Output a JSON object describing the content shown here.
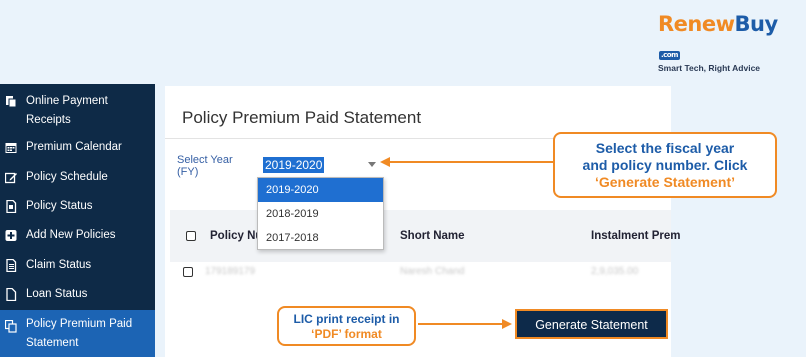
{
  "logo": {
    "renew": "Renew",
    "buy": "Buy",
    "com": ".com",
    "tagline": "Smart Tech, Right Advice"
  },
  "sidebar": {
    "items": [
      {
        "label": "Online Payment Receipts",
        "icon": "receipt-icon"
      },
      {
        "label": "Premium Calendar",
        "icon": "calendar-icon"
      },
      {
        "label": "Policy Schedule",
        "icon": "edit-icon"
      },
      {
        "label": "Policy Status",
        "icon": "document-icon"
      },
      {
        "label": "Add New Policies",
        "icon": "plus-icon"
      },
      {
        "label": "Claim Status",
        "icon": "list-icon"
      },
      {
        "label": "Loan Status",
        "icon": "file-icon"
      },
      {
        "label": "Policy Premium Paid Statement",
        "icon": "copy-icon",
        "active": true
      }
    ]
  },
  "main": {
    "title": "Policy Premium Paid Statement",
    "fy_label": "Select Year (FY)",
    "fy_value": "2019-2020",
    "dropdown_options": [
      "2019-2020",
      "2018-2019",
      "2017-2018"
    ],
    "table": {
      "headers": [
        "Policy Nu",
        "Short Name",
        "Instalment Prem"
      ],
      "row_blurred": [
        "179189179",
        "Naresh Chand",
        "2,9,035.00"
      ]
    },
    "generate_button": "Generate Statement"
  },
  "callouts": {
    "fiscal_line1": "Select the fiscal year",
    "fiscal_line2": "and policy number. Click",
    "fiscal_line3": "‘Generate Statement’",
    "pdf_line1": "LIC print receipt in",
    "pdf_line2": "‘PDF’ format"
  },
  "colors": {
    "sidebar_bg": "#0e2a47",
    "active_item": "#1c64b4",
    "accent_orange": "#f08a24",
    "brand_blue": "#1d5ca8",
    "selection_blue": "#1f6fd1"
  }
}
